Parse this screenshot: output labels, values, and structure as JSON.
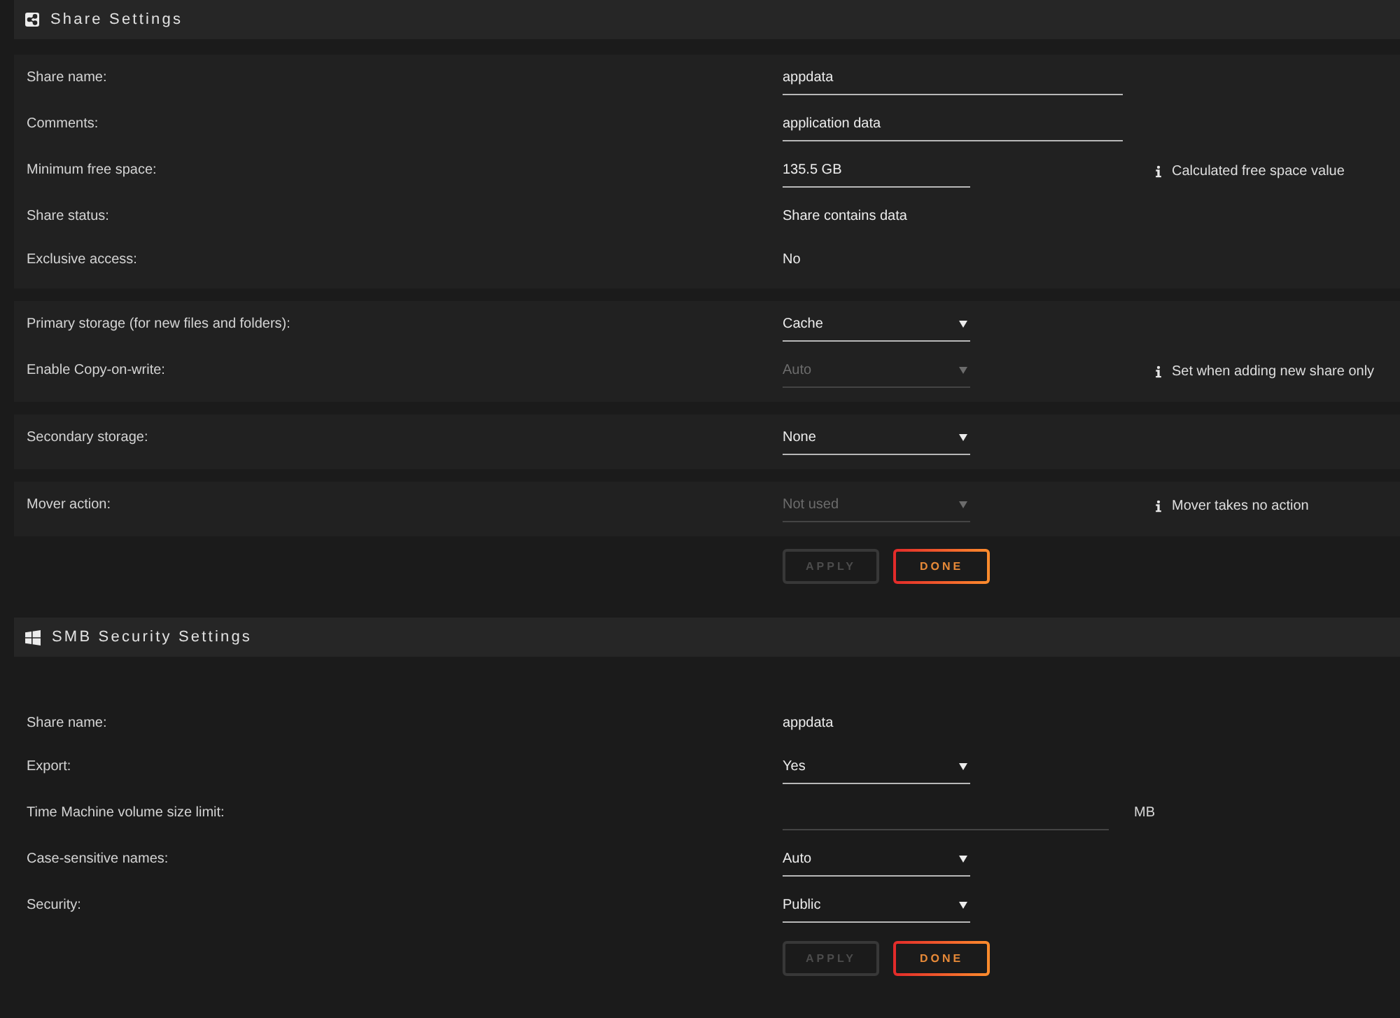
{
  "sections": [
    {
      "kind": "share",
      "title": "Share Settings",
      "groups": [
        {
          "rows": [
            {
              "label": "Share name:",
              "kind": "input",
              "wide": true,
              "disabled": false,
              "value": "appdata"
            },
            {
              "label": "Comments:",
              "kind": "input",
              "wide": true,
              "disabled": false,
              "value": "application data"
            },
            {
              "label": "Minimum free space:",
              "kind": "input",
              "wide": false,
              "disabled": false,
              "value": "135.5 GB",
              "note": "Calculated free space value"
            },
            {
              "label": "Share status:",
              "kind": "text",
              "value": "Share contains data"
            },
            {
              "label": "Exclusive access:",
              "kind": "text",
              "value": "No"
            }
          ]
        },
        {
          "rows": [
            {
              "label": "Primary storage (for new files and folders):",
              "kind": "select",
              "disabled": false,
              "value": "Cache"
            },
            {
              "label": "Enable Copy-on-write:",
              "kind": "select",
              "disabled": true,
              "value": "Auto",
              "note": "Set when adding new share only"
            }
          ]
        },
        {
          "rows": [
            {
              "label": "Secondary storage:",
              "kind": "select",
              "disabled": false,
              "value": "None"
            }
          ]
        },
        {
          "rows": [
            {
              "label": "Mover action:",
              "kind": "select",
              "disabled": true,
              "value": "Not used",
              "note": "Mover takes no action"
            }
          ]
        }
      ],
      "buttons": [
        {
          "label": "APPLY",
          "disabled": true
        },
        {
          "label": "DONE",
          "disabled": false
        }
      ]
    },
    {
      "kind": "smb",
      "title": "SMB Security Settings",
      "rows": [
        {
          "label": "Share name:",
          "kind": "text",
          "value": "appdata"
        },
        {
          "label": "Export:",
          "kind": "select",
          "disabled": false,
          "value": "Yes"
        },
        {
          "label": "Time Machine volume size limit:",
          "kind": "input",
          "wide": true,
          "disabled": true,
          "unit": "MB"
        },
        {
          "label": "Case-sensitive names:",
          "kind": "select",
          "disabled": false,
          "value": "Auto"
        },
        {
          "label": "Security:",
          "kind": "select",
          "disabled": false,
          "value": "Public"
        }
      ],
      "buttons": [
        {
          "label": "APPLY",
          "disabled": true
        },
        {
          "label": "DONE",
          "disabled": false
        }
      ]
    }
  ]
}
